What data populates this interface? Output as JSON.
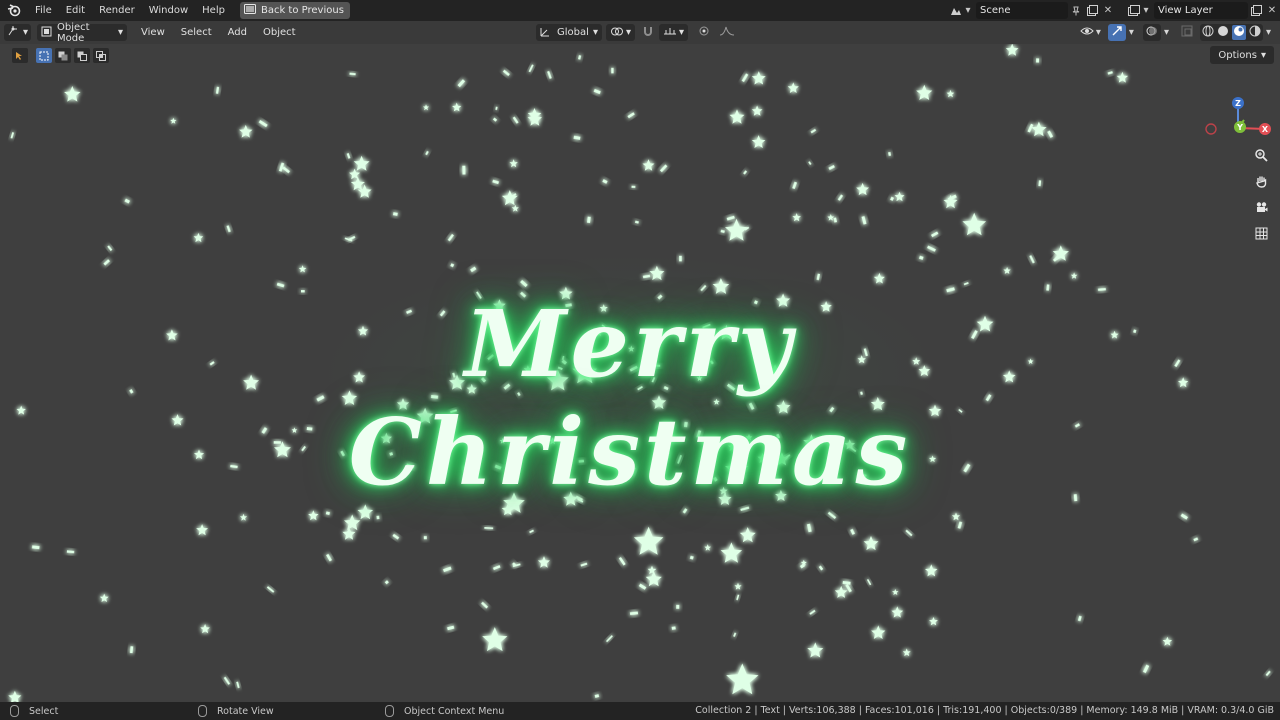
{
  "topbar": {
    "menus": [
      "File",
      "Edit",
      "Render",
      "Window",
      "Help"
    ],
    "back_button": "Back to Previous",
    "scene_name": "Scene",
    "view_layer": "View Layer"
  },
  "header": {
    "mode": "Object Mode",
    "menus": [
      "View",
      "Select",
      "Add",
      "Object"
    ],
    "transform_orientation": "Global"
  },
  "viewport": {
    "text_object": "Merry Christmas",
    "options_label": "Options",
    "gizmo_axes": {
      "z": "Z",
      "x": "X",
      "y": "Y"
    },
    "glow_color": "#35e86d"
  },
  "statusbar": {
    "hints": [
      "Select",
      "Rotate View",
      "Object Context Menu"
    ],
    "stats": "Collection 2 | Text | Verts:106,388 | Faces:101,016 | Tris:191,400 | Objects:0/389 | Memory: 149.8 MiB | VRAM: 0.3/4.0 GiB"
  }
}
